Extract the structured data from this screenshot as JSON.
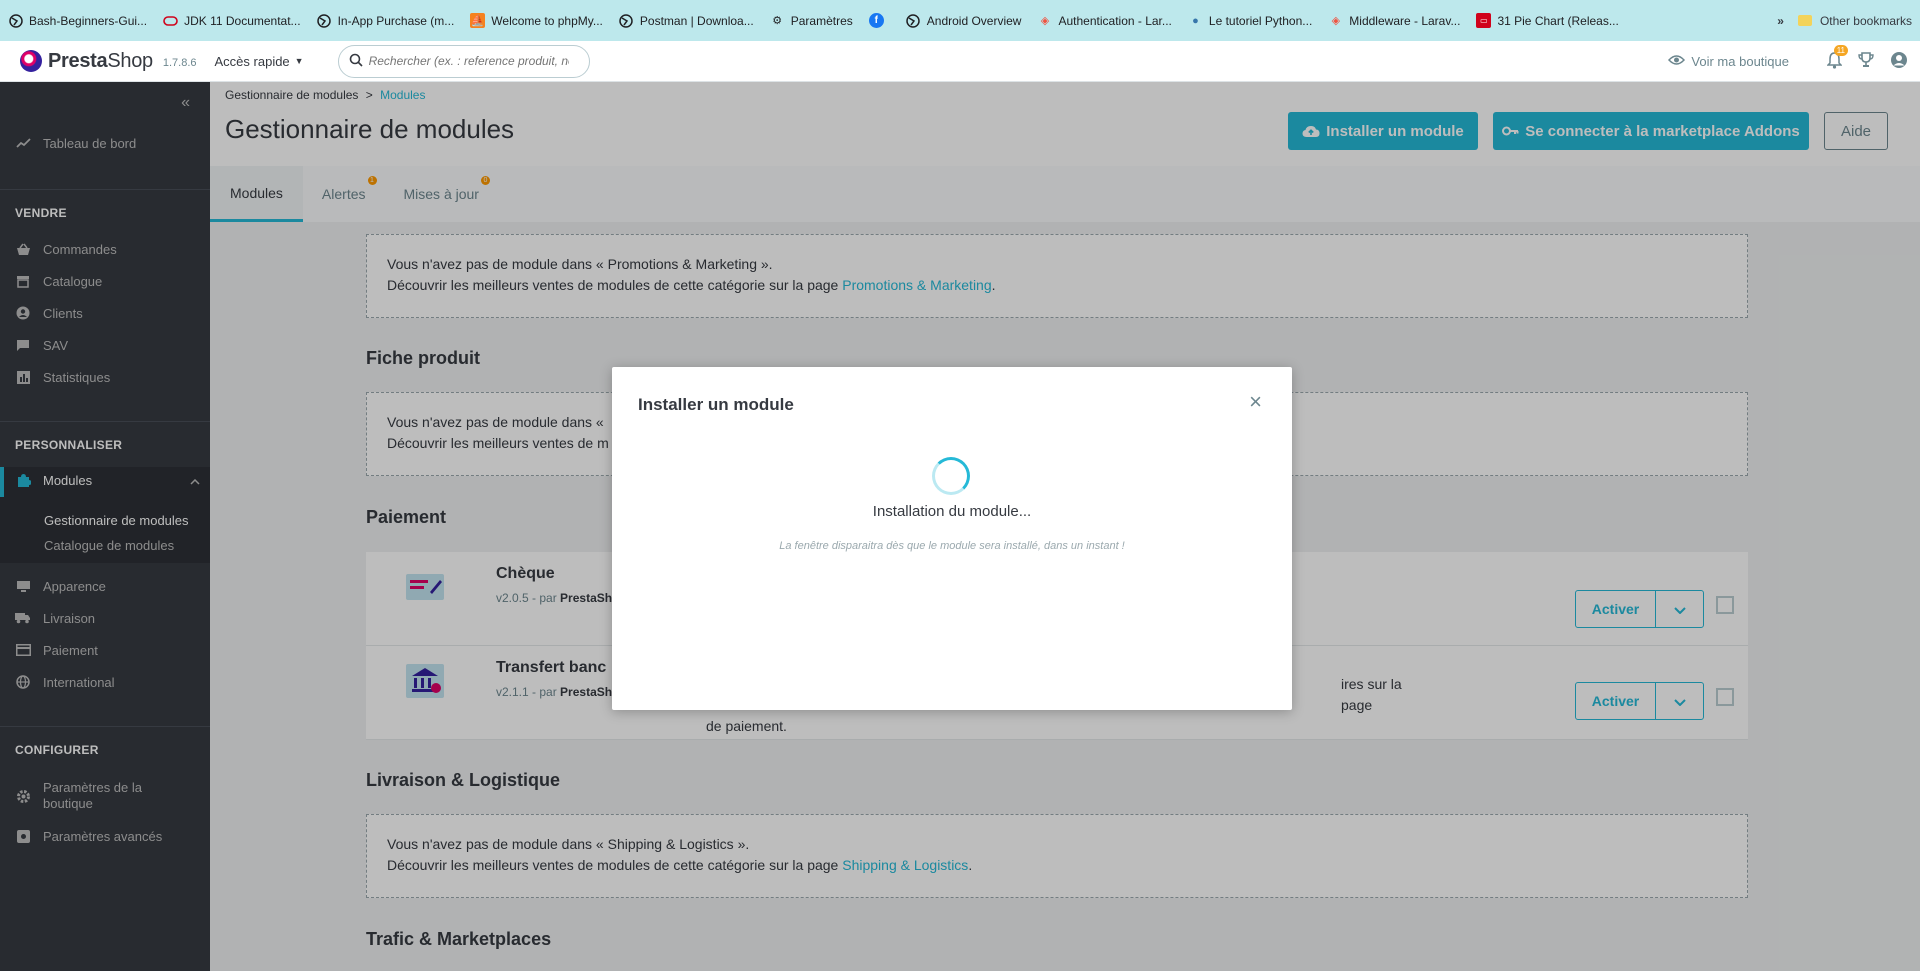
{
  "bookmarks": {
    "items": [
      {
        "label": "Bash-Beginners-Gui...",
        "icon": "globe-icon"
      },
      {
        "label": "JDK 11 Documentat...",
        "icon": "oracle-icon"
      },
      {
        "label": "In-App Purchase (m...",
        "icon": "globe-icon"
      },
      {
        "label": "Welcome to phpMy...",
        "icon": "phpmyadmin-icon"
      },
      {
        "label": "Postman | Downloa...",
        "icon": "globe-icon"
      },
      {
        "label": "Paramètres",
        "icon": "gear-icon"
      },
      {
        "label": "",
        "icon": "facebook-icon"
      },
      {
        "label": "Android Overview",
        "icon": "globe-icon"
      },
      {
        "label": "Authentication - Lar...",
        "icon": "laravel-icon"
      },
      {
        "label": "Le tutoriel Python...",
        "icon": "python-icon"
      },
      {
        "label": "Middleware - Larav...",
        "icon": "laravel-icon"
      },
      {
        "label": "31 Pie Chart (Releas...",
        "icon": "oracle-icon"
      }
    ],
    "overflow": "»",
    "other": "Other bookmarks"
  },
  "header": {
    "brand_bold": "Presta",
    "brand_rest": "Shop",
    "version": "1.7.8.6",
    "quick_access": "Accès rapide",
    "search_placeholder": "Rechercher (ex. : reference produit, no",
    "view_shop": "Voir ma boutique",
    "notifications_count": "11"
  },
  "sidebar": {
    "dashboard": "Tableau de bord",
    "section_sell": "VENDRE",
    "orders": "Commandes",
    "catalog": "Catalogue",
    "customers": "Clients",
    "sav": "SAV",
    "stats": "Statistiques",
    "section_customize": "PERSONNALISER",
    "modules": "Modules",
    "module_manager": "Gestionnaire de modules",
    "module_catalog": "Catalogue de modules",
    "appearance": "Apparence",
    "shipping": "Livraison",
    "payment": "Paiement",
    "international": "International",
    "section_configure": "CONFIGURER",
    "shop_params_1": "Paramètres de la",
    "shop_params_2": "boutique",
    "advanced_params": "Paramètres avancés"
  },
  "page": {
    "breadcrumb_parent": "Gestionnaire de modules",
    "breadcrumb_sep": ">",
    "breadcrumb_current": "Modules",
    "title": "Gestionnaire de modules",
    "btn_install": "Installer un module",
    "btn_marketplace": "Se connecter à la marketplace Addons",
    "btn_help": "Aide",
    "tabs": [
      {
        "label": "Modules",
        "badge": ""
      },
      {
        "label": "Alertes",
        "badge": "1"
      },
      {
        "label": "Mises à jour",
        "badge": "0"
      }
    ]
  },
  "content": {
    "promo_line1": "Vous n'avez pas de module dans « Promotions & Marketing ».",
    "promo_line2": "Découvrir les meilleurs ventes de modules de cette catégorie sur la page",
    "promo_link": "Promotions & Marketing",
    "cat_product": "Fiche produit",
    "product_line1": "Vous n'avez pas de module dans «",
    "product_line2": "Découvrir les meilleurs ventes de m",
    "cat_payment": "Paiement",
    "modules": [
      {
        "name": "Chèque",
        "version": "v2.0.5 - par",
        "author": "PrestaSh",
        "desc": "",
        "action": "Activer"
      },
      {
        "name": "Transfert banc",
        "version": "v2.1.1 - par",
        "author": "PrestaSh",
        "desc": "ires sur la page",
        "desc2": "de paiement.",
        "action": "Activer"
      }
    ],
    "cat_shipping": "Livraison & Logistique",
    "ship_line1": "Vous n'avez pas de module dans « Shipping & Logistics ».",
    "ship_line2": "Découvrir les meilleurs ventes de modules de cette catégorie sur la page",
    "ship_link": "Shipping & Logistics",
    "cat_traffic": "Trafic & Marketplaces"
  },
  "modal": {
    "title": "Installer un module",
    "close": "×",
    "status": "Installation du module...",
    "note": "La fenêtre disparaitra dès que le module sera installé, dans un instant !"
  }
}
